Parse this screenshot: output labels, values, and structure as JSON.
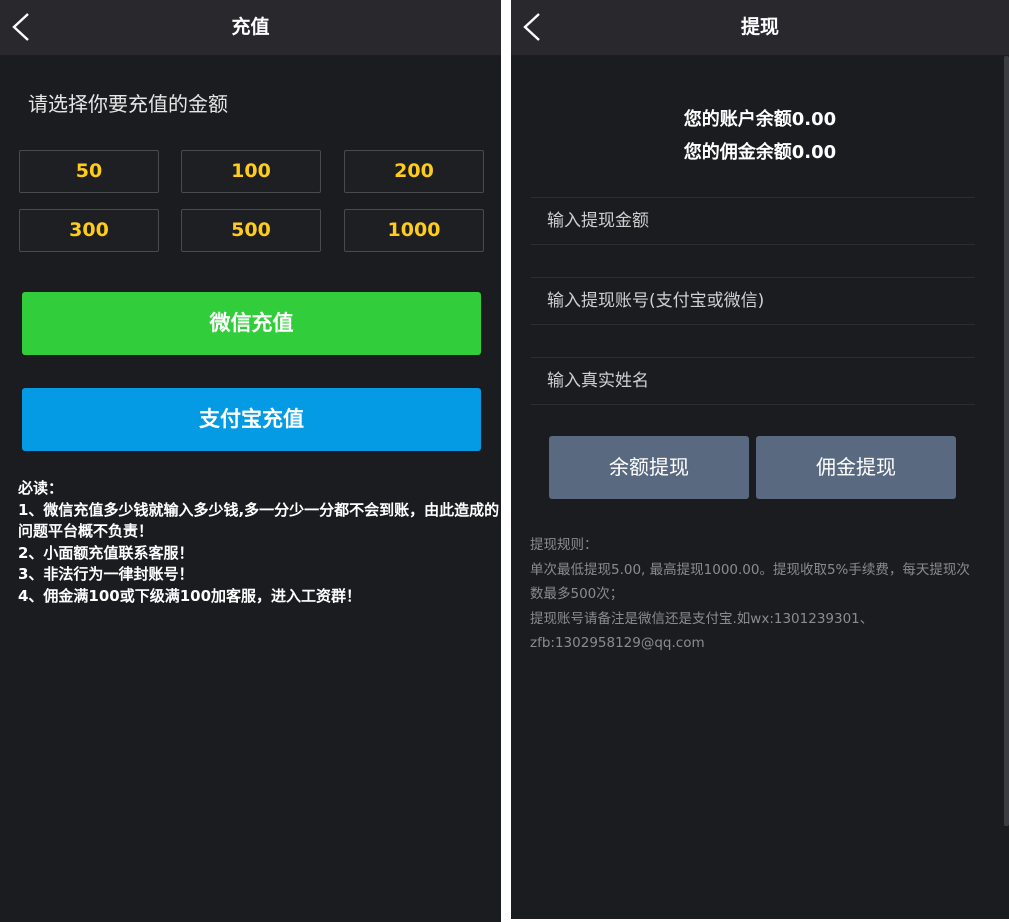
{
  "recharge": {
    "title": "充值",
    "prompt": "请选择你要充值的金额",
    "amounts": [
      "50",
      "100",
      "200",
      "300",
      "500",
      "1000"
    ],
    "wechat_button": "微信充值",
    "alipay_button": "支付宝充值",
    "notes": {
      "heading": "必读：",
      "line1": "1、微信充值多少钱就输入多少钱,多一分少一分都不会到账，由此造成的问题平台概不负责！",
      "line2": "2、小面额充值联系客服！",
      "line3": "3、非法行为一律封账号！",
      "line4": "4、佣金满100或下级满100加客服，进入工资群！"
    },
    "colors": {
      "wechat": "#32cd3a",
      "alipay": "#049be4",
      "amount_text": "#ffcc1a"
    }
  },
  "withdraw": {
    "title": "提现",
    "account_balance": "您的账户余额0.00",
    "commission_balance": "您的佣金余额0.00",
    "amount_placeholder": "输入提现金额",
    "account_placeholder": "输入提现账号(支付宝或微信)",
    "name_placeholder": "输入真实姓名",
    "balance_button": "余额提现",
    "commission_button": "佣金提现",
    "rules": {
      "heading": "提现规则：",
      "line1": "单次最低提现5.00, 最高提现1000.00。提现收取5%手续费，每天提现次数最多500次；",
      "line2": "提现账号请备注是微信还是支付宝.如wx:1301239301、zfb:1302958129@qq.com"
    },
    "colors": {
      "button": "#586980"
    }
  },
  "icons": {
    "back": "chevron-left-icon"
  }
}
